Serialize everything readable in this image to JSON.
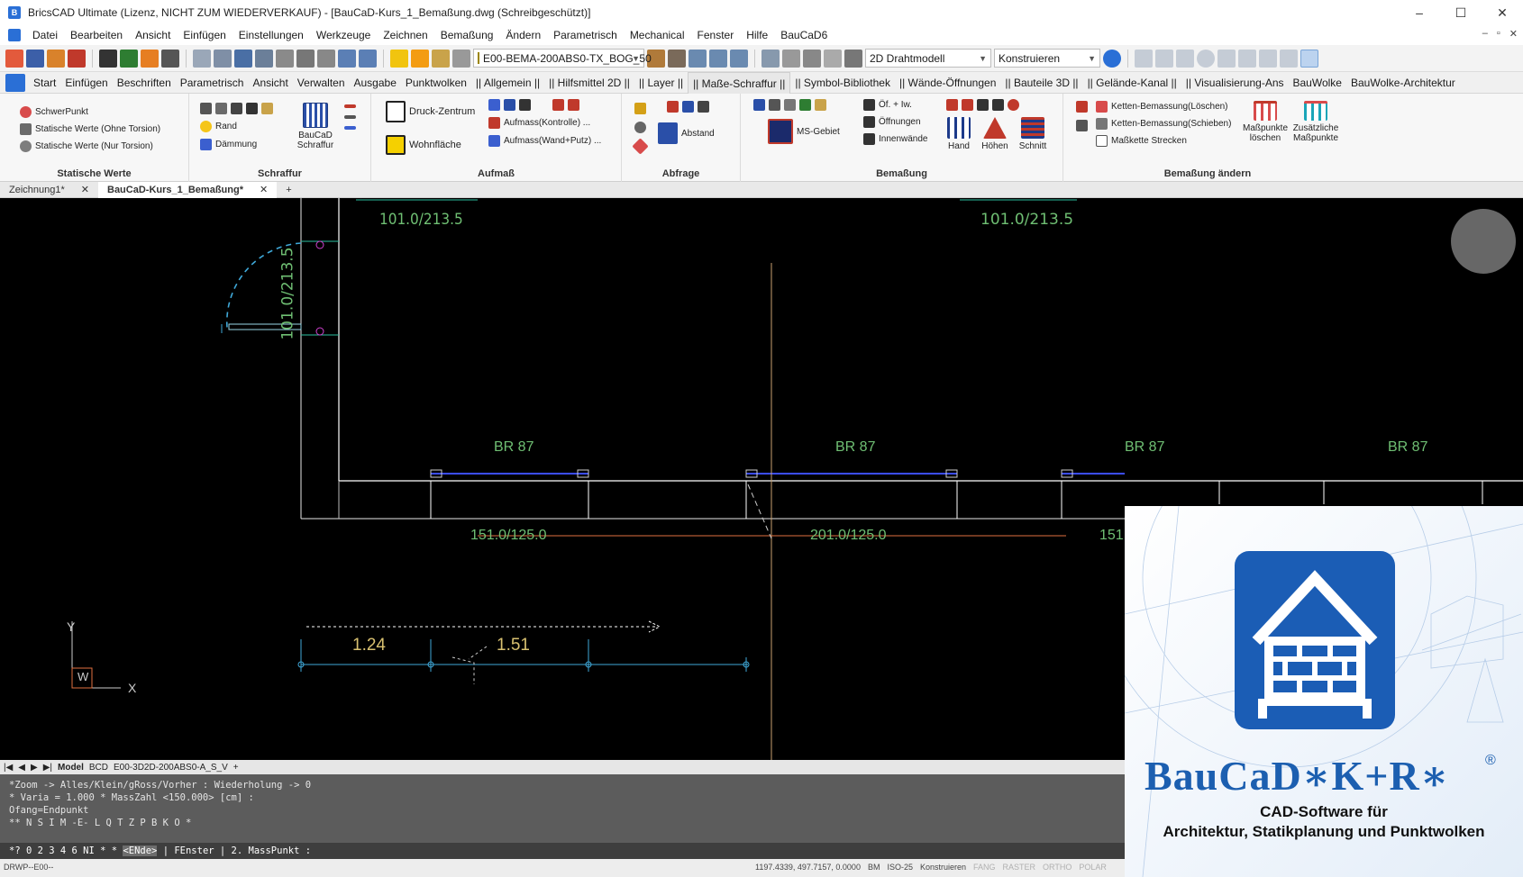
{
  "window": {
    "title": "BricsCAD Ultimate (Lizenz, NICHT ZUM WIEDERVERKAUF) - [BauCaD-Kurs_1_Bemaßung.dwg (Schreibgeschützt)]",
    "minimize": "–",
    "maximize": "☐",
    "close": "✕"
  },
  "menu": [
    "Datei",
    "Bearbeiten",
    "Ansicht",
    "Einfügen",
    "Einstellungen",
    "Werkzeuge",
    "Zeichnen",
    "Bemaßung",
    "Ändern",
    "Parametrisch",
    "Mechanical",
    "Fenster",
    "Hilfe",
    "BauCaD6"
  ],
  "menu_controls": [
    "–",
    "▫",
    "✕"
  ],
  "toolbar": {
    "layer_combo": "E00-BEMA-200ABS0-TX_BOG_50",
    "visual_style": "2D Drahtmodell",
    "workspace": "Konstruieren"
  },
  "ribbon_tabs": [
    "Start",
    "Einfügen",
    "Beschriften",
    "Parametrisch",
    "Ansicht",
    "Verwalten",
    "Ausgabe",
    "Punktwolken",
    "|| Allgemein ||",
    "|| Hilfsmittel 2D ||",
    "|| Layer ||",
    "|| Maße-Schraffur ||",
    "|| Symbol-Bibliothek",
    "|| Wände-Öffnungen",
    "|| Bauteile 3D ||",
    "|| Gelände-Kanal ||",
    "|| Visualisierung-Ans",
    "BauWolke",
    "BauWolke-Architektur"
  ],
  "ribbon": {
    "statische_werte": {
      "title": "Statische Werte",
      "items": [
        "SchwerPunkt",
        "Statische Werte (Ohne Torsion)",
        "Statische Werte (Nur Torsion)"
      ]
    },
    "schraffur": {
      "title": "Schraffur",
      "items": [
        "Rand",
        "Dämmung"
      ],
      "big": "BauCaD Schraffur"
    },
    "aufmass": {
      "title": "Aufmaß",
      "items": [
        "Druck-Zentrum",
        "Wohnfläche",
        "Aufmass(Kontrolle) ...",
        "Aufmass(Wand+Putz) ..."
      ]
    },
    "abfrage": {
      "title": "Abfrage",
      "items": [
        "Abstand"
      ]
    },
    "bemassung": {
      "title": "Bemaßung",
      "items": [
        "MS-Gebiet",
        "Öf. + Iw.",
        "Öffnungen",
        "Innenwände",
        "Hand",
        "Höhen",
        "Schnitt"
      ]
    },
    "bemassung_aendern": {
      "title": "Bemaßung ändern",
      "items": [
        "Ketten-Bemassung(Löschen)",
        "Ketten-Bemassung(Schieben)",
        "Maßkette Strecken",
        "Maßpunkte löschen",
        "Zusätzliche Maßpunkte"
      ]
    }
  },
  "doc_tabs": [
    {
      "label": "Zeichnung1*",
      "close": "✕"
    },
    {
      "label": "BauCaD-Kurs_1_Bemaßung*",
      "close": "✕"
    }
  ],
  "doc_tab_add": "+",
  "drawing": {
    "dims": [
      "101.0/213.5",
      "101.0/213.5",
      "101.0/213.5",
      "BR 87",
      "BR 87",
      "BR 87",
      "BR 87",
      "151.0/125.0",
      "201.0/125.0",
      "151",
      "1.24",
      "1.51"
    ],
    "ucs": {
      "y": "Y",
      "x": "X",
      "w": "W"
    }
  },
  "layout_tabs": [
    "Model",
    "BCD",
    "E00-3D2D-200ABS0-A_S_V",
    "+"
  ],
  "command_history": [
    "*Zoom -> Alles/Klein/gRoss/Vorher : Wiederholung -> 0",
    "* Varia = 1.000 * MassZahl <150.000> [cm] :",
    "Ofang=Endpunkt",
    "** N S I M -E- L Q T Z P B K O *"
  ],
  "command_prompt": {
    "prefix": "*? 0 2 3 4 6 NI * * ",
    "highlight": "<ENde>",
    "suffix": " | FEnster | 2. MassPunkt :"
  },
  "status": {
    "left": "DRWP--E00--",
    "coords": "1197.4339, 497.7157, 0.0000",
    "items": [
      "BM",
      "ISO-25",
      "Konstruieren"
    ],
    "dim_items": [
      "FANG",
      "RASTER",
      "ORTHO",
      "POLAR"
    ]
  },
  "logo": {
    "brand": "BauCaD∗K+R∗",
    "reg": "®",
    "tagline1": "CAD-Software für",
    "tagline2": "Architektur, Statikplanung und Punktwolken"
  },
  "colors": {
    "accent": "#2a6fd6",
    "canvas": "#000000",
    "dim_text": "#6fbf73",
    "wall": "#ffffff",
    "window_blue": "#3b4dff",
    "brand_blue": "#1c5fb0"
  }
}
